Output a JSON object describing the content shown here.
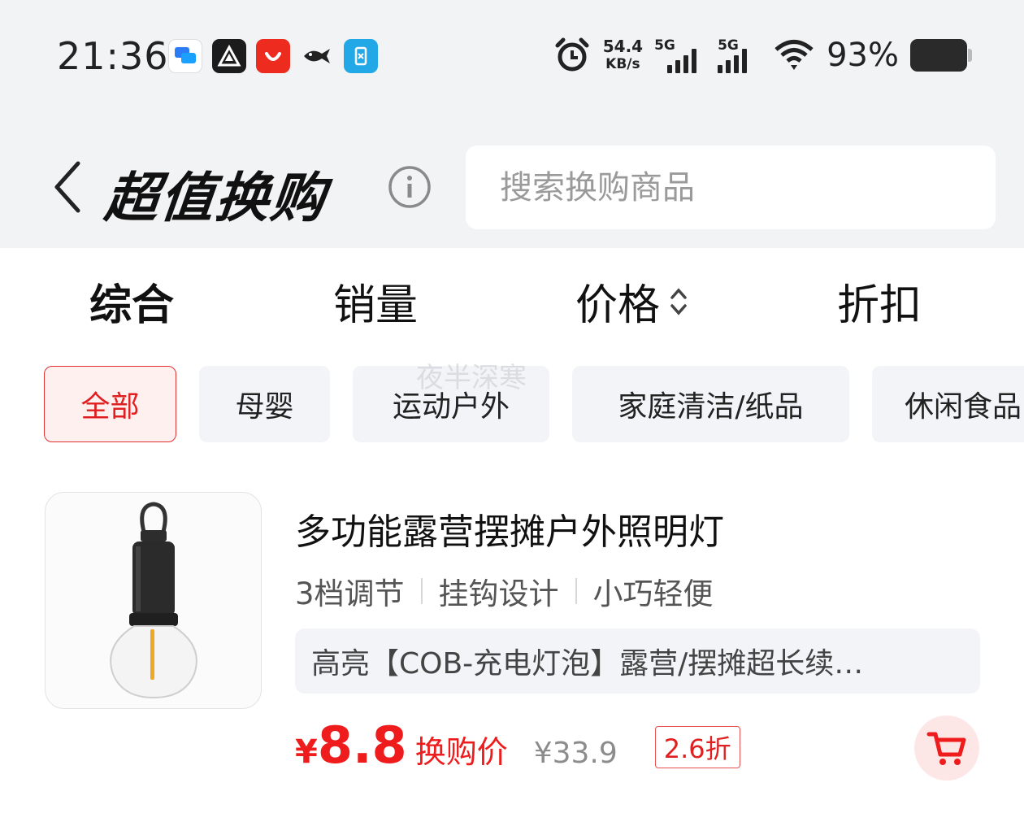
{
  "status_bar": {
    "time": "21:36",
    "net_speed_value": "54.4",
    "net_speed_unit": "KB/s",
    "signal1_label": "5G",
    "signal2_label": "5G",
    "battery_percent": "93%"
  },
  "header": {
    "title": "超值换购",
    "search_placeholder": "搜索换购商品"
  },
  "sort_tabs": [
    {
      "label": "综合",
      "active": true
    },
    {
      "label": "销量",
      "active": false
    },
    {
      "label": "价格",
      "active": false
    },
    {
      "label": "折扣",
      "active": false
    }
  ],
  "categories": [
    {
      "label": "全部",
      "active": true
    },
    {
      "label": "母婴",
      "active": false
    },
    {
      "label": "运动户外",
      "active": false
    },
    {
      "label": "家庭清洁/纸品",
      "active": false
    },
    {
      "label": "休闲食品",
      "active": false
    }
  ],
  "watermark": "夜半深寒",
  "product": {
    "title": "多功能露营摆摊户外照明灯",
    "features": [
      "3档调节",
      "挂钩设计",
      "小巧轻便"
    ],
    "description": "高亮【COB-充电灯泡】露营/摆摊超长续…",
    "price_symbol": "¥",
    "price": "8.8",
    "price_label": "换购价",
    "original_price": "¥33.9",
    "discount": "2.6折"
  },
  "colors": {
    "accent_red": "#ee1c1c",
    "background_top": "#f2f3f5",
    "chip_bg": "#f3f4f7"
  }
}
